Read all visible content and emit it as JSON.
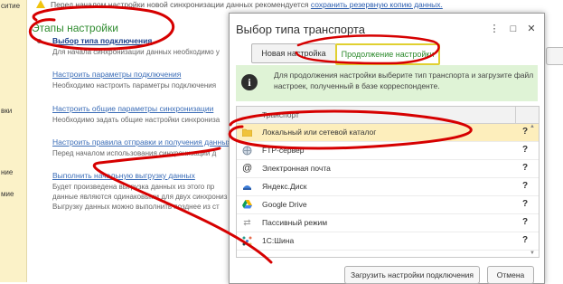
{
  "left_strip": {
    "items": [
      "ситие",
      "вки",
      "ние",
      "мие"
    ]
  },
  "top_warning": {
    "text": "Перед началом настройки новой синхронизации данных рекомендуется ",
    "link": "сохранить резервную копию данных."
  },
  "stages": {
    "title": "Этапы настройки",
    "steps": [
      {
        "link": "Выбор типа подключения",
        "desc": "Для начала синхронизации данных необходимо у"
      },
      {
        "link": "Настроить параметры подключения",
        "desc": "Необходимо настроить параметры подключения"
      },
      {
        "link": "Настроить общие параметры синхронизации",
        "desc": "Необходимо задать общие настройки синхрониза"
      },
      {
        "link": "Настроить правила отправки и получения данных",
        "desc": "Перед началом использования синхронизации д"
      },
      {
        "link": "Выполнить начальную выгрузку данных",
        "desc": "Будет произведена выгрузка данных из этого пр",
        "desc2": "данные являются одинаковыми для двух синхрониз",
        "desc3": "Выгрузку данных можно выполнить позднее из ст"
      }
    ]
  },
  "dialog": {
    "title": "Выбор типа транспорта",
    "title_buttons": [
      "⋮",
      "□",
      "✕"
    ],
    "tabs": [
      "Новая настройка",
      "Продолжение настройки"
    ],
    "active_tab": 1,
    "info_text": "Для продолжения настройки выберите тип транспорта и загрузите файл настроек, полученный в базе корреспонденте.",
    "table": {
      "header": "Транспорт",
      "rows": [
        {
          "icon": "folder-icon",
          "label": "Локальный или сетевой каталог",
          "q": "?"
        },
        {
          "icon": "ftp-icon",
          "label": "FTP-сервер",
          "q": "?"
        },
        {
          "icon": "email-icon",
          "label": "Электронная почта",
          "q": "?"
        },
        {
          "icon": "yandex-disk-icon",
          "label": "Яндекс.Диск",
          "q": "?"
        },
        {
          "icon": "google-drive-icon",
          "label": "Google Drive",
          "q": "?"
        },
        {
          "icon": "passive-mode-icon",
          "label": "Пассивный режим",
          "q": "?"
        },
        {
          "icon": "1c-bus-icon",
          "label": "1С:Шина",
          "q": "?"
        }
      ],
      "selected_row": 0
    },
    "buttons": {
      "load": "Загрузить настройки подключения",
      "cancel": "Отмена"
    }
  },
  "colors": {
    "annotation": "#d60000",
    "accent_green": "#2c8a2c",
    "selected_row": "#fdeebc"
  }
}
